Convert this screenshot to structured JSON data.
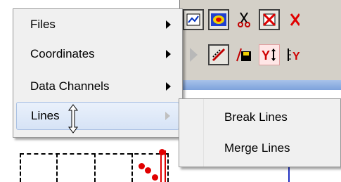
{
  "menu": {
    "items": [
      {
        "label": "Files",
        "has_submenu": true
      },
      {
        "label": "Coordinates",
        "has_submenu": true
      },
      {
        "label": "Data Channels",
        "has_submenu": true
      },
      {
        "label": "Lines",
        "has_submenu": true,
        "active": true
      }
    ]
  },
  "submenu": {
    "items": [
      {
        "label": "Break Lines"
      },
      {
        "label": "Merge Lines"
      }
    ]
  },
  "toolbar": {
    "row1_icons": [
      "line-chart-icon",
      "color-map-icon",
      "cut-icon",
      "delete-icon",
      "close-icon"
    ],
    "row2_icons": [
      "play-icon",
      "line-tool-icon",
      "save-icon",
      "y-scale-icon",
      "y-axis-icon"
    ]
  },
  "colors": {
    "menu_bg": "#f0f0f0",
    "highlight": "#d6e3f6",
    "toolbar_bg": "#d4d0c8",
    "plot_red": "#e00000"
  }
}
